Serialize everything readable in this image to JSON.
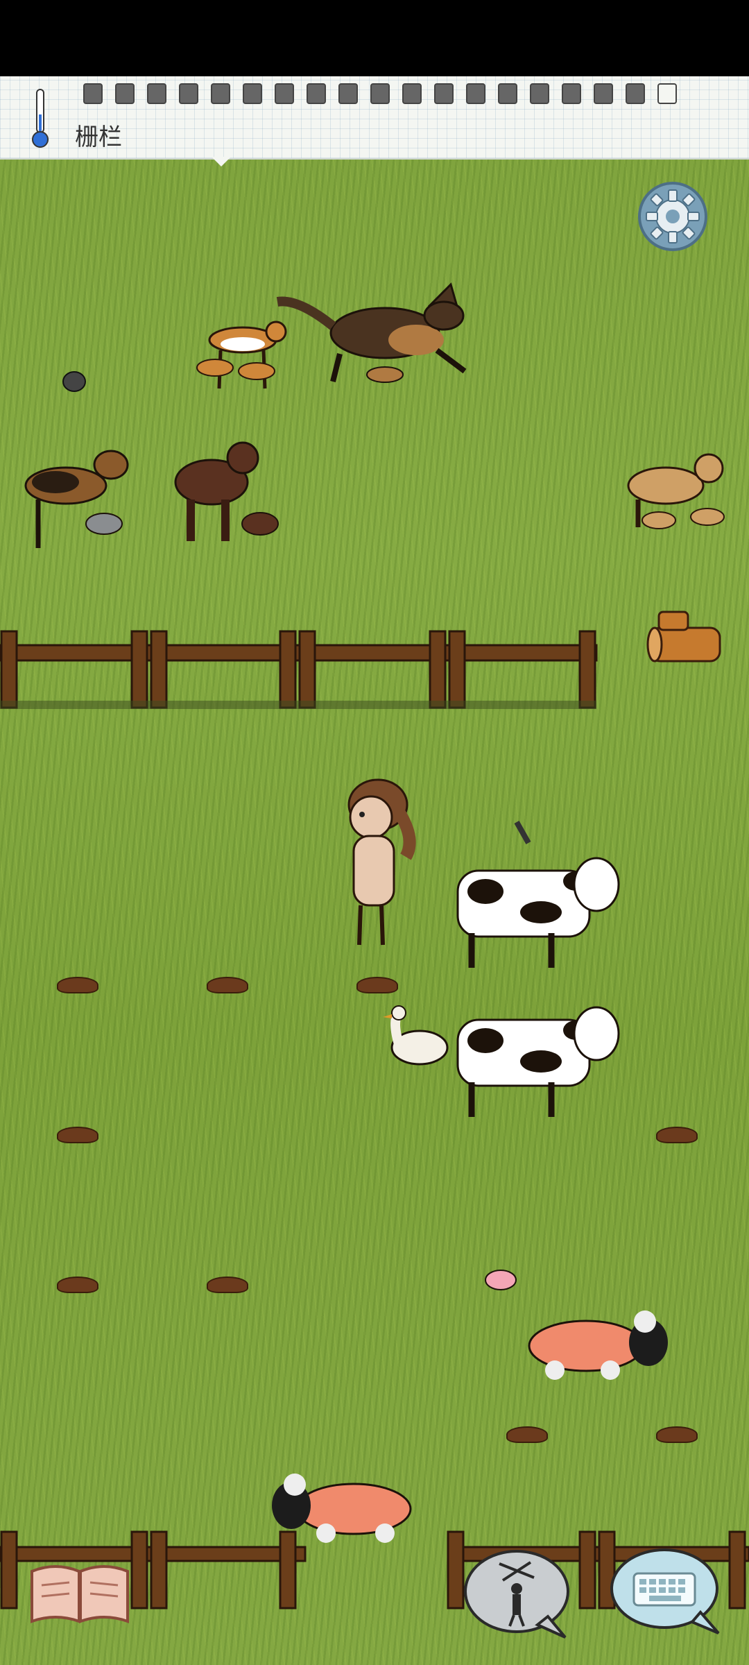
{
  "topbar": {
    "hint_label": "栅栏",
    "temperature_icon": "thermometer-icon",
    "food_slots_filled": 18,
    "food_slots_total": 19
  },
  "buttons": {
    "settings_icon": "gear-icon",
    "tech_book_icon": "book-icon",
    "emote_icon": "puppet-emote-icon",
    "keyboard_icon": "keyboard-icon"
  },
  "colors": {
    "grass": "#84a842",
    "fence_wood": "#6b3e1a",
    "topbar_paper": "#f4f6f2"
  }
}
